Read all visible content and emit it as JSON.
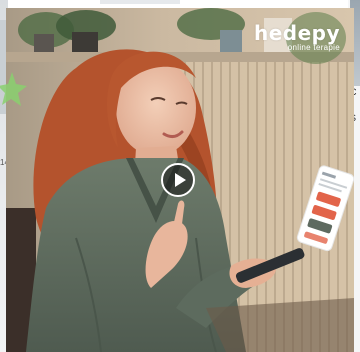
{
  "video": {
    "brand_name": "hedepy",
    "brand_tagline": "online terapie",
    "play_label": ""
  },
  "neighbors": {
    "right_letters": [
      "C",
      "t",
      "S"
    ],
    "left_number": "14"
  },
  "colors": {
    "brand_white": "#ffffff",
    "jacket_green": "#5f6e60",
    "hair_red": "#b3522c",
    "background_wood": "#cdb79c",
    "sticker_green": "#8ad06f",
    "phone_card_red": "#e2644a"
  },
  "icons": {
    "play": "play-icon",
    "star": "star-sticker-icon"
  }
}
